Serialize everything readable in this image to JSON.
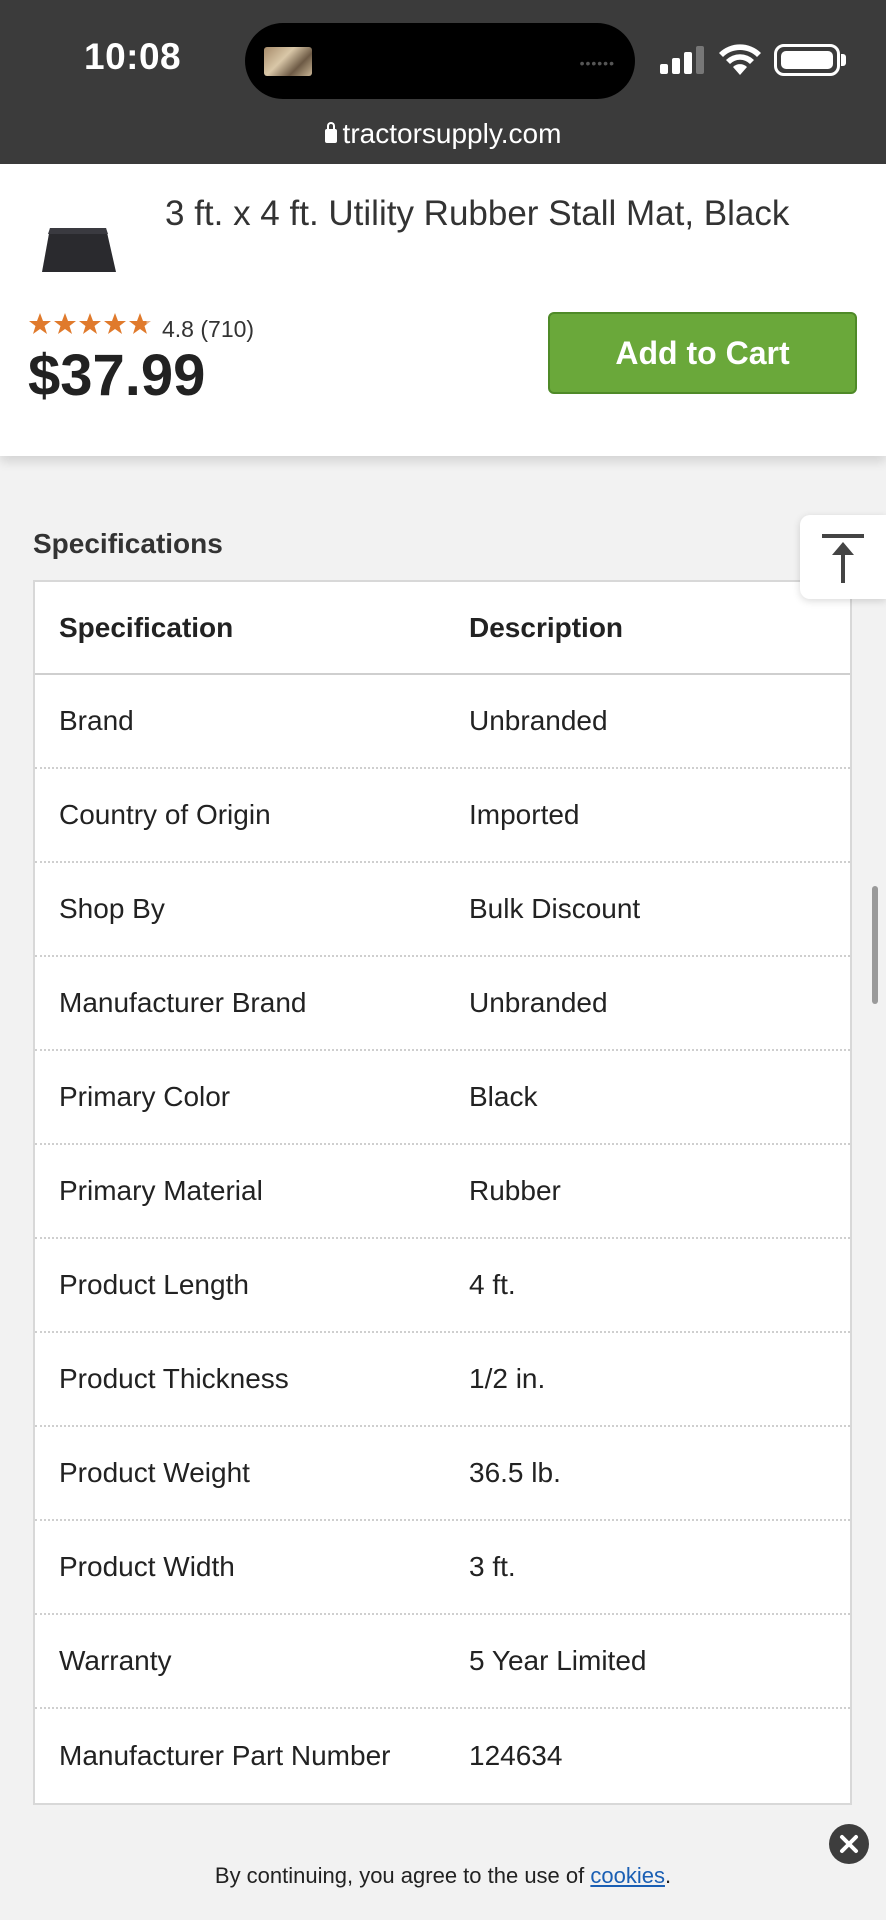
{
  "status_bar": {
    "time": "10:08",
    "url": "tractorsupply.com",
    "icons": [
      "signal-icon",
      "wifi-icon",
      "battery-icon",
      "lock-icon"
    ]
  },
  "product": {
    "title": "3 ft. x 4 ft. Utility Rubber Stall Mat, Black",
    "rating": 4.8,
    "rating_text": "4.8 (710)",
    "price": "$37.99",
    "add_to_cart_label": "Add to Cart",
    "colors": {
      "button": "#6aa83a",
      "stars": "#e07a2c"
    }
  },
  "specifications": {
    "heading": "Specifications",
    "columns": [
      "Specification",
      "Description"
    ],
    "rows": [
      [
        "Brand",
        "Unbranded"
      ],
      [
        "Country of Origin",
        "Imported"
      ],
      [
        "Shop By",
        "Bulk Discount"
      ],
      [
        "Manufacturer Brand",
        "Unbranded"
      ],
      [
        "Primary Color",
        "Black"
      ],
      [
        "Primary Material",
        "Rubber"
      ],
      [
        "Product Length",
        "4 ft."
      ],
      [
        "Product Thickness",
        "1/2 in."
      ],
      [
        "Product Weight",
        "36.5 lb."
      ],
      [
        "Product Width",
        "3 ft."
      ],
      [
        "Warranty",
        "5 Year Limited"
      ],
      [
        "Manufacturer Part Number",
        "124634"
      ]
    ]
  },
  "cookie_banner": {
    "text_before": "By continuing, you agree to the use of ",
    "link_text": "cookies",
    "text_after": "."
  }
}
